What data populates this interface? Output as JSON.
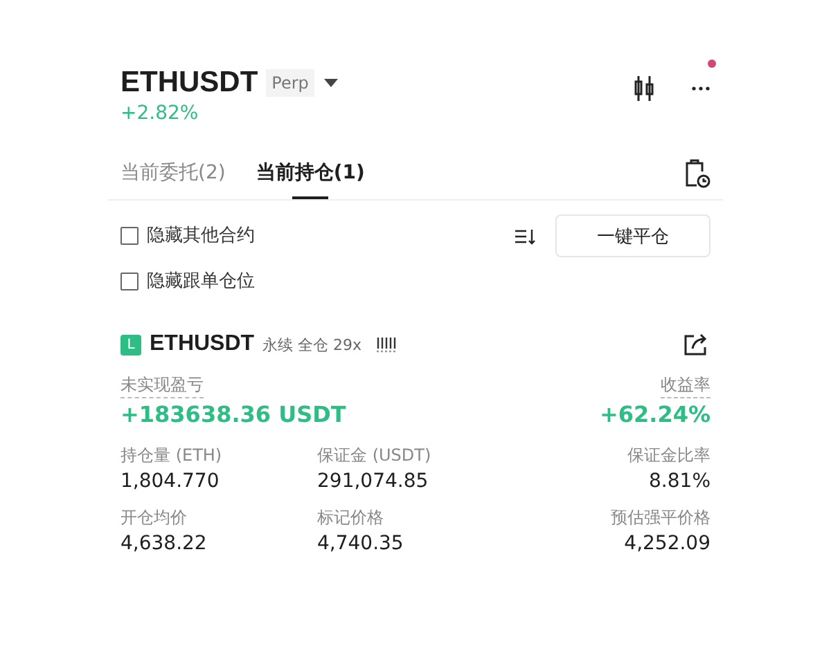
{
  "header": {
    "symbol": "ETHUSDT",
    "badge": "Perp",
    "change": "+2.82%",
    "notification": true
  },
  "tabs": [
    {
      "label": "当前委托(2)",
      "selected": false
    },
    {
      "label": "当前持仓(1)",
      "selected": true
    }
  ],
  "filters": [
    {
      "label": "隐藏其他合约",
      "checked": false
    },
    {
      "label": "隐藏跟单仓位",
      "checked": false
    }
  ],
  "close_all_button": "一键平仓",
  "position": {
    "side": "L",
    "symbol": "ETHUSDT",
    "tags": "永续 全仓 29x",
    "pnl_label": "未实现盈亏",
    "pnl": "+183638.36 USDT",
    "roe_label": "收益率",
    "roe": "+62.24%",
    "stats": [
      {
        "label": "持仓量 (ETH)",
        "value": "1,804.770"
      },
      {
        "label": "保证金 (USDT)",
        "value": "291,074.85"
      },
      {
        "label": "保证金比率",
        "value": "8.81%"
      },
      {
        "label": "开仓均价",
        "value": "4,638.22"
      },
      {
        "label": "标记价格",
        "value": "4,740.35"
      },
      {
        "label": "预估强平价格",
        "value": "4,252.09"
      }
    ]
  }
}
